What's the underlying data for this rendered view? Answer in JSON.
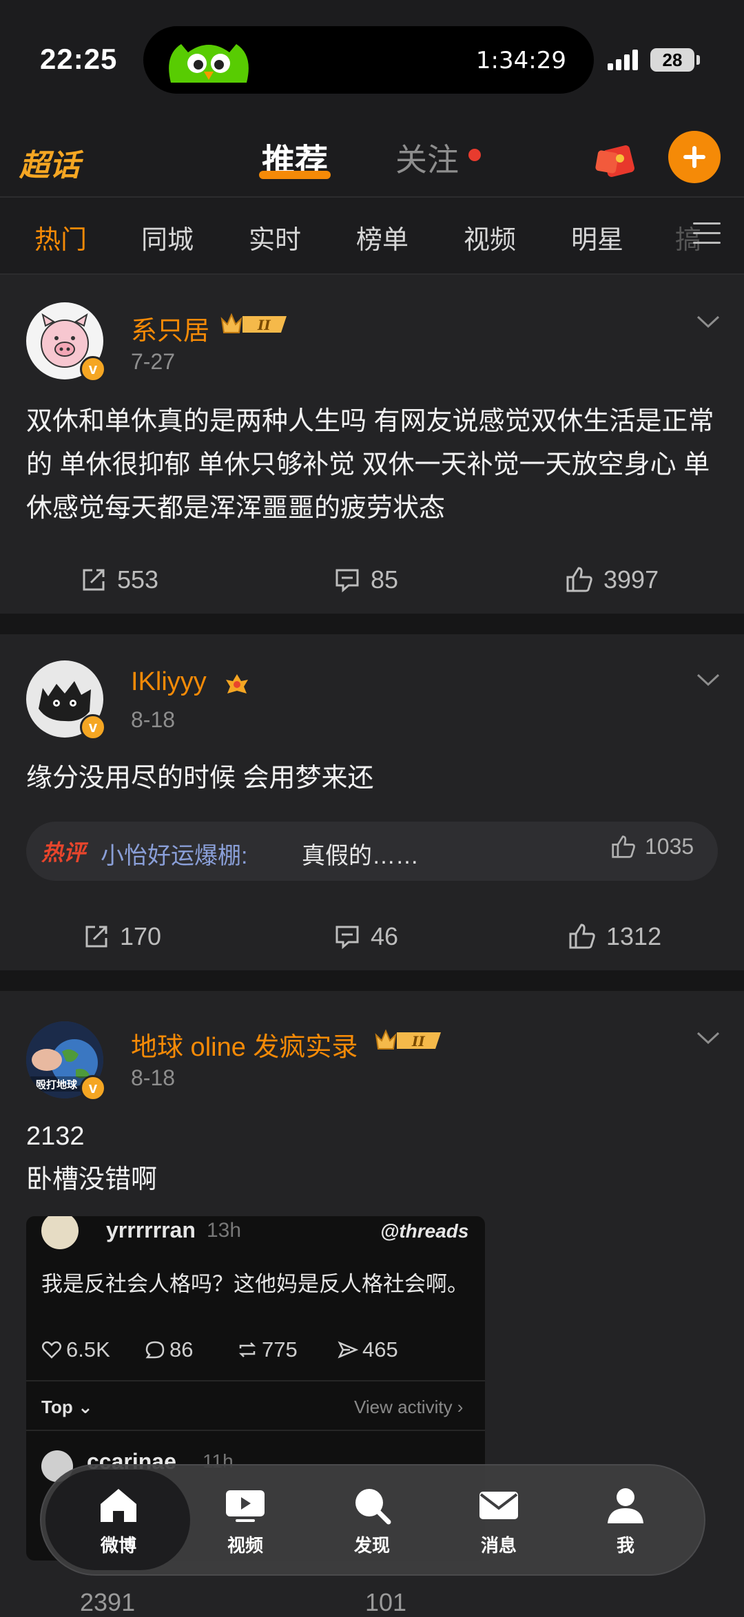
{
  "status": {
    "time": "22:25",
    "timer": "1:34:29",
    "battery": "28"
  },
  "topnav": {
    "chaohua": "超话",
    "tab_recommend": "推荐",
    "tab_follow": "关注"
  },
  "categories": [
    "热门",
    "同城",
    "实时",
    "榜单",
    "视频",
    "明星"
  ],
  "category_fade": "搞",
  "posts": [
    {
      "user": "系只居",
      "date": "7-27",
      "content": "双休和单休真的是两种人生吗 有网友说感觉双休生活是正常的 单休很抑郁 单休只够补觉 双休一天补觉一天放空身心 单休感觉每天都是浑浑噩噩的疲劳状态",
      "reposts": "553",
      "comments": "85",
      "likes": "3997"
    },
    {
      "user": "IKliyyy",
      "date": "8-18",
      "content": "缘分没用尽的时候 会用梦来还",
      "hot_comment": {
        "tag": "热评",
        "user": "小怡好运爆棚:",
        "text": "真假的……",
        "likes": "1035"
      },
      "reposts": "170",
      "comments": "46",
      "likes": "1312"
    },
    {
      "user": "地球 oline 发疯实录",
      "date": "8-18",
      "avatar_text": "殴打地球",
      "content_line1": "2132",
      "content_line2": "卧槽没错啊",
      "embed": {
        "user": "yrrrrrran",
        "time": "13h",
        "brand": "threads",
        "text": "我是反社会人格吗？这他妈是反人格社会啊。",
        "likes": "6.5K",
        "comments": "86",
        "reposts": "775",
        "shares": "465",
        "sort_label": "Top",
        "view_activity": "View activity",
        "reply_user": "ccarinae",
        "reply_time": "11h"
      },
      "reposts": "2391",
      "comments": "101"
    }
  ],
  "bottomnav": [
    "微博",
    "视频",
    "发现",
    "消息",
    "我"
  ],
  "colors": {
    "accent": "#f58a07",
    "background": "#1c1c1e",
    "card": "#232325"
  }
}
